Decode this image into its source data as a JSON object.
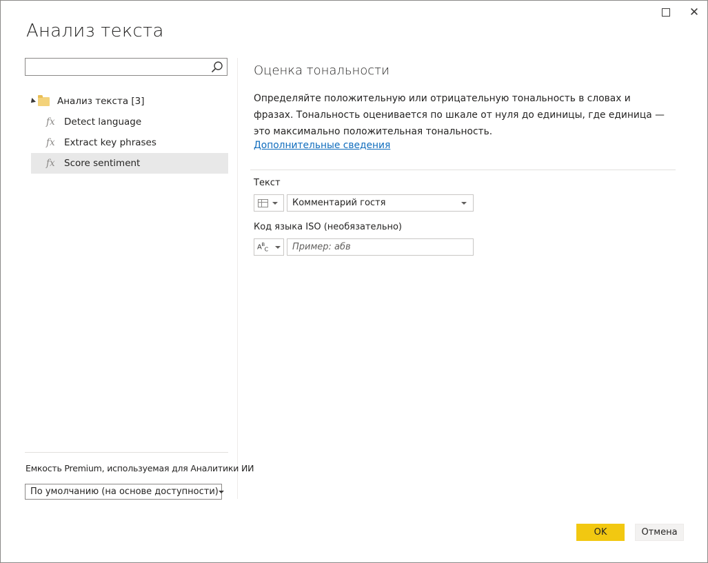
{
  "window": {
    "title": "Анализ текста",
    "maximize_icon": "maximize-icon",
    "close_icon": "close-icon"
  },
  "sidebar": {
    "search_placeholder": "",
    "search_icon": "search-icon",
    "tree": {
      "folder_label": "Анализ текста [3]",
      "items": [
        {
          "label": "Detect language",
          "icon": "function-icon",
          "selected": false
        },
        {
          "label": "Extract key phrases",
          "icon": "function-icon",
          "selected": false
        },
        {
          "label": "Score sentiment",
          "icon": "function-icon",
          "selected": true
        }
      ]
    },
    "capacity_label": "Емкость Premium, используемая для Аналитики ИИ",
    "capacity_value": "По умолчанию (на основе доступности)"
  },
  "main": {
    "section_title": "Оценка тональности",
    "description": "Определяйте положительную или отрицательную тональность в словах и фразах. Тональность оценивается по шкале от нуля до единицы, где единица — это максимально положительная тональность.",
    "more_link": "Дополнительные сведения",
    "text_field": {
      "label": "Текст",
      "type_icon": "column-table-icon",
      "value": "Комментарий гостя"
    },
    "iso_field": {
      "label": "Код языка ISO (необязательно)",
      "type_icon": "text-abc-icon",
      "placeholder": "Пример: абв",
      "value": ""
    }
  },
  "footer": {
    "ok_label": "OK",
    "cancel_label": "Отмена"
  },
  "colors": {
    "accent_ok": "#f2c811",
    "link": "#0f6cbd",
    "selected_row": "#e8e8e8"
  }
}
